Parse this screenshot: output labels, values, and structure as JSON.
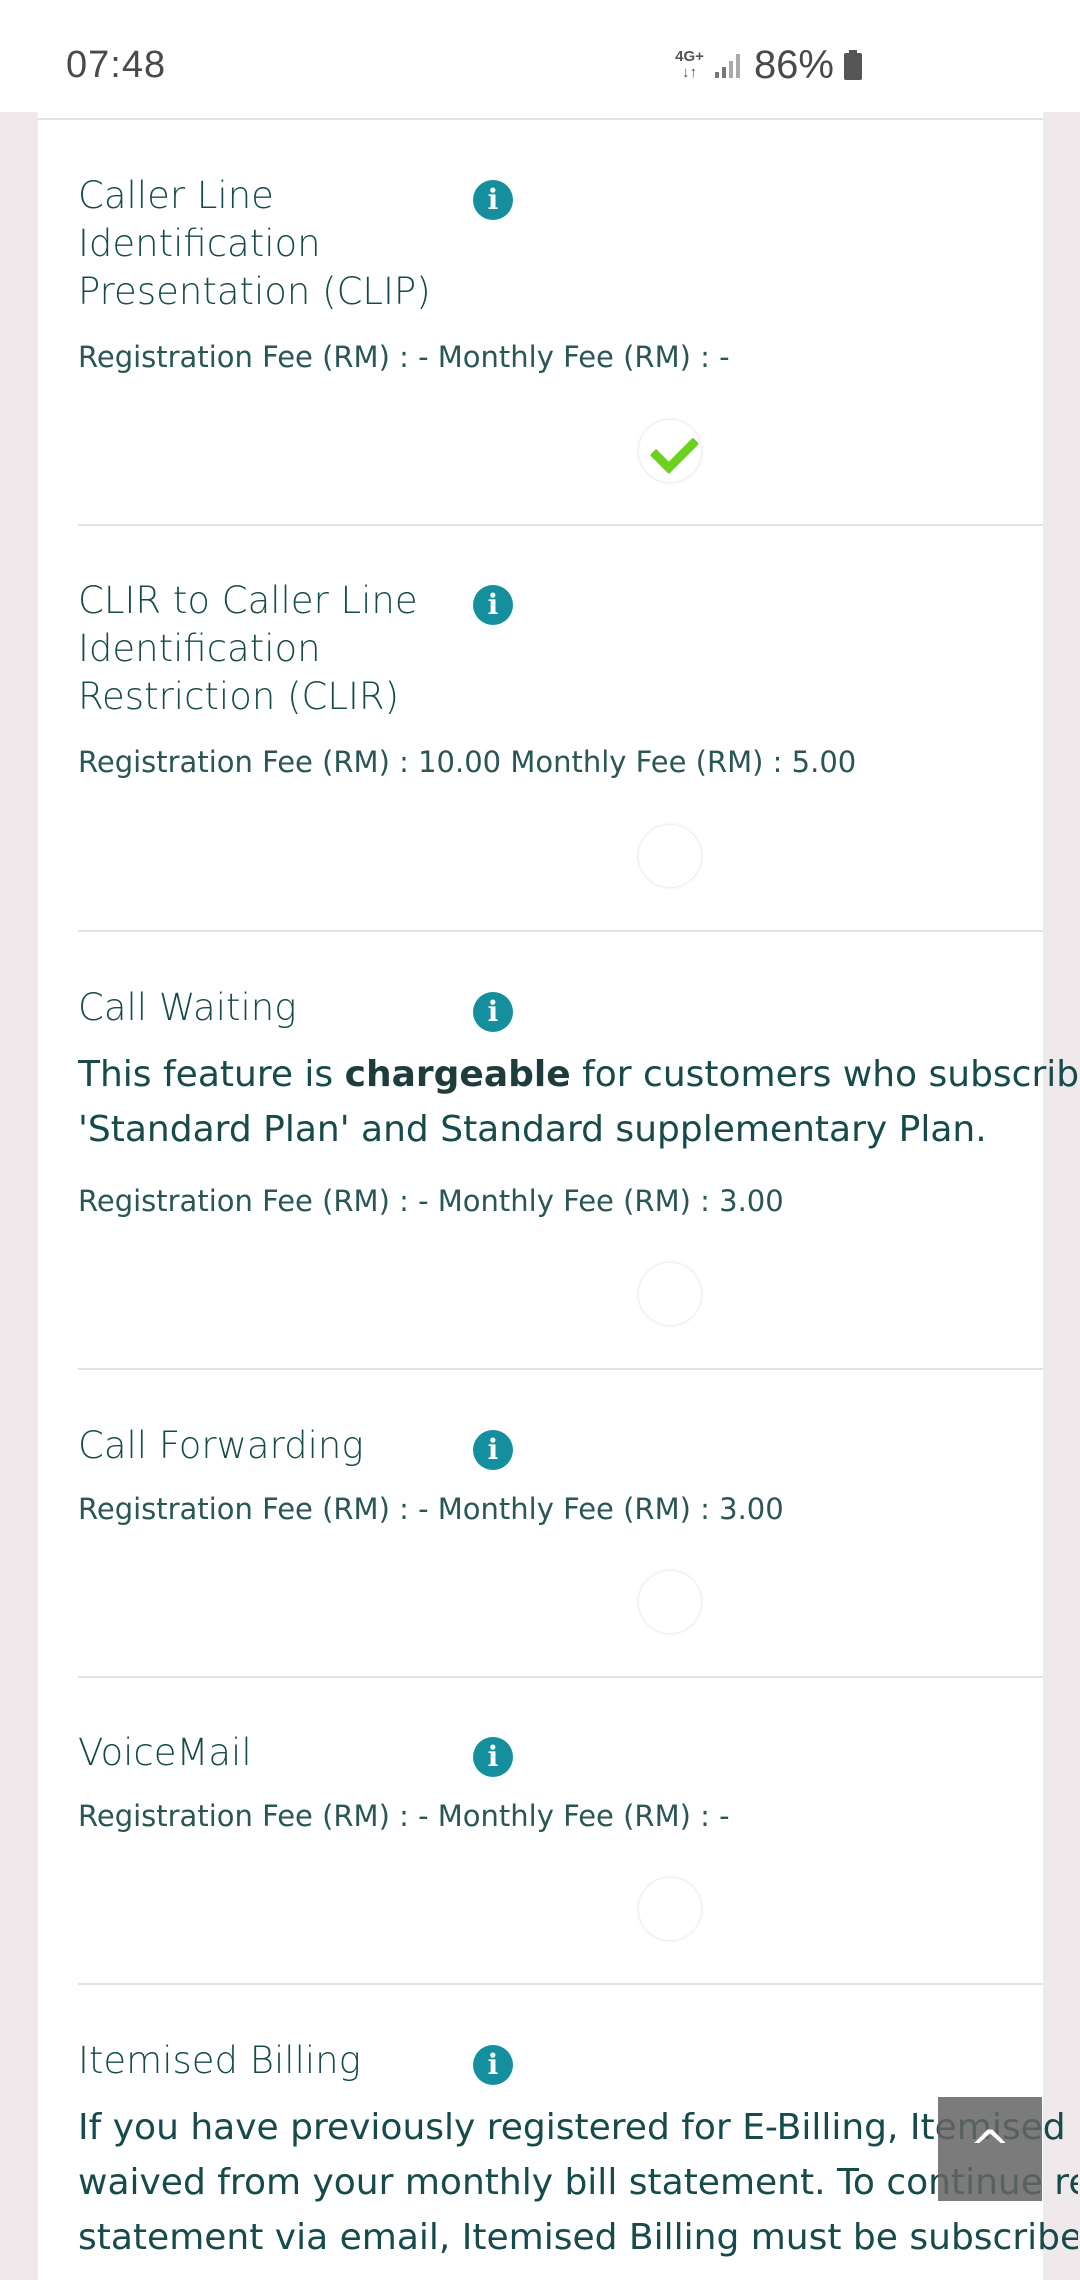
{
  "status": {
    "time": "07:48",
    "network_top": "4G+",
    "network_bottom": "↓↑",
    "battery": "86%",
    "icons": [
      "network-type-icon",
      "signal-icon",
      "battery-icon"
    ]
  },
  "features": [
    {
      "title": "Caller Line\nIdentification\nPresentation (CLIP)",
      "fees": "Registration Fee (RM) : - Monthly Fee (RM) : -",
      "selected": true
    },
    {
      "title": "CLIR to Caller Line\nIdentification\nRestriction (CLIR)",
      "fees": "Registration Fee (RM) : 10.00 Monthly Fee (RM) : 5.00",
      "selected": false
    },
    {
      "title": "Call Waiting",
      "desc_line1_pre": "This feature is ",
      "desc_line1_bold": "chargeable",
      "desc_line1_post": " for customers who subscribe to",
      "desc_line2": "'Standard Plan' and Standard supplementary Plan.",
      "fees": "Registration Fee (RM) : - Monthly Fee (RM) : 3.00",
      "selected": false
    },
    {
      "title": "Call Forwarding",
      "fees": "Registration Fee (RM) : - Monthly Fee (RM) : 3.00",
      "selected": false
    },
    {
      "title": "VoiceMail",
      "fees": "Registration Fee (RM) : - Monthly Fee (RM) : -",
      "selected": false
    },
    {
      "title": "Itemised Billing",
      "desc_line1": "If you have previously registered for E-Billing, Itemised Bill",
      "desc_line2": "waived from your monthly bill statement. To continue rece",
      "desc_line3": "statement via email, Itemised Billing must be subscribed."
    }
  ],
  "info_icon_glyph": "i",
  "scroll_top_glyph": "^",
  "colors": {
    "accent": "#158f9e",
    "check": "#6bd11e",
    "text": "#174b4b",
    "background": "#efe9ec"
  }
}
